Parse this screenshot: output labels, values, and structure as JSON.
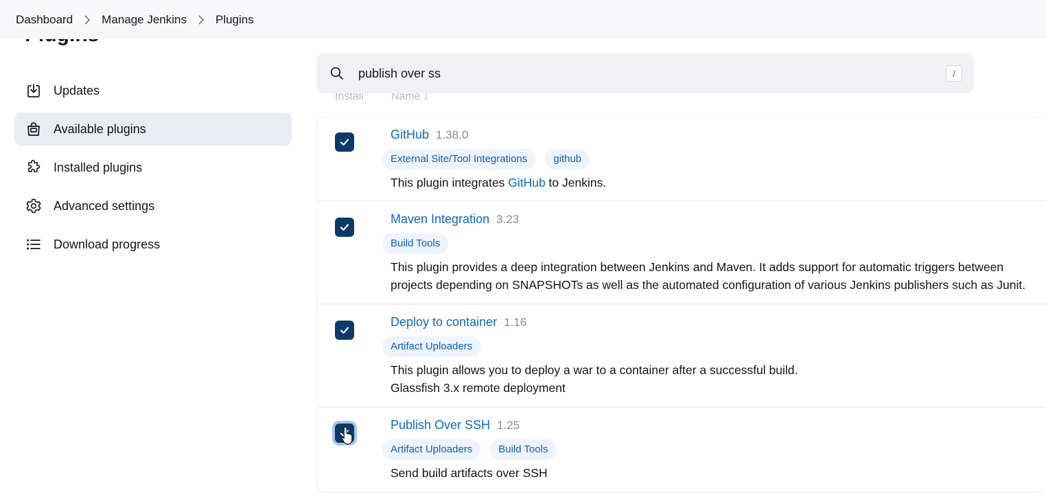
{
  "breadcrumb": [
    "Dashboard",
    "Manage Jenkins",
    "Plugins"
  ],
  "page_title": "Plugins",
  "sidebar": {
    "items": [
      {
        "label": "Updates",
        "icon": "download-icon",
        "active": false
      },
      {
        "label": "Available plugins",
        "icon": "shopping-bag-icon",
        "active": true
      },
      {
        "label": "Installed plugins",
        "icon": "puzzle-icon",
        "active": false
      },
      {
        "label": "Advanced settings",
        "icon": "gear-icon",
        "active": false
      },
      {
        "label": "Download progress",
        "icon": "list-icon",
        "active": false
      }
    ]
  },
  "search": {
    "value": "publish over ss",
    "shortcut": "/"
  },
  "table": {
    "columns": [
      "Install",
      "Name ↓"
    ],
    "rows": [
      {
        "name": "GitHub",
        "version": "1.38.0",
        "tags": [
          "External Site/Tool Integrations",
          "github"
        ],
        "desc_pre": "This plugin integrates ",
        "desc_link": "GitHub",
        "desc_post": " to Jenkins.",
        "checked": true
      },
      {
        "name": "Maven Integration",
        "version": "3.23",
        "tags": [
          "Build Tools"
        ],
        "desc_lines": [
          "This plugin provides a deep integration between Jenkins and Maven. It adds support for automatic triggers between",
          "projects depending on SNAPSHOTs as well as the automated configuration of various Jenkins publishers such as Junit."
        ],
        "checked": true
      },
      {
        "name": "Deploy to container",
        "version": "1.16",
        "tags": [
          "Artifact Uploaders"
        ],
        "desc_lines": [
          "This plugin allows you to deploy a war to a container after a successful build.",
          "Glassfish 3.x remote deployment"
        ],
        "checked": true
      },
      {
        "name": "Publish Over SSH",
        "version": "1.25",
        "tags": [
          "Artifact Uploaders",
          "Build Tools"
        ],
        "desc_lines": [
          "Send build artifacts over SSH"
        ],
        "checked": true
      }
    ]
  },
  "colors": {
    "accent": "#0a68d0",
    "checkbox": "#0b3a69",
    "active_nav": "#ebebf2"
  }
}
